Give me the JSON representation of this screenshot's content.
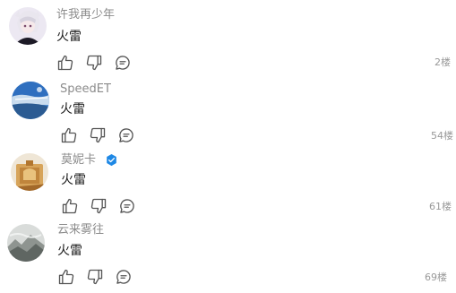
{
  "comments": [
    {
      "username": "许我再少年",
      "content": "火雷",
      "floor": "2楼",
      "verified": false
    },
    {
      "username": "SpeedET",
      "content": "火雷",
      "floor": "54楼",
      "verified": false
    },
    {
      "username": "莫妮卡",
      "content": "火雷",
      "floor": "61楼",
      "verified": true
    },
    {
      "username": "云来雾往",
      "content": "火雷",
      "floor": "69楼",
      "verified": false
    }
  ],
  "icons": {
    "like": "thumbs-up-icon",
    "dislike": "thumbs-down-icon",
    "reply": "comment-bubble-icon",
    "verified": "verified-badge-icon"
  },
  "colors": {
    "text": "#1a1a1a",
    "username": "#8c8c8c",
    "floor": "#999999",
    "icon": "#555555",
    "verified_badge": "#1e88e5"
  }
}
